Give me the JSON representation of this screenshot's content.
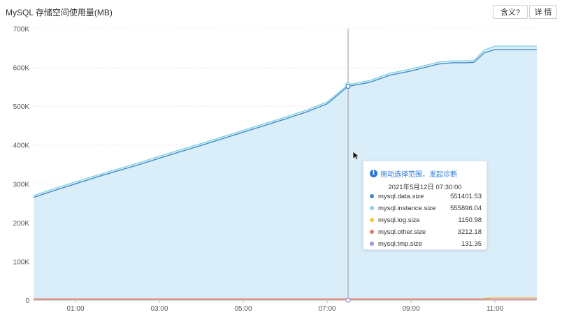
{
  "title": "MySQL 存储空间使用量(MB)",
  "buttons": {
    "meaning": "含义?",
    "detail": "详 情"
  },
  "tooltip": {
    "header": "拖动选择范围，发起诊断",
    "time": "2021年5月12日 07:30:00",
    "rows": [
      {
        "name": "mysql.data.size",
        "value": "551401.53",
        "color": "#3d85c6"
      },
      {
        "name": "mysql.instance.size",
        "value": "555896.04",
        "color": "#7fd3e0"
      },
      {
        "name": "mysql.log.size",
        "value": "1150.98",
        "color": "#f2c744"
      },
      {
        "name": "mysql.other.size",
        "value": "3212.18",
        "color": "#e8786f"
      },
      {
        "name": "mysql.tmp.size",
        "value": "131.35",
        "color": "#a88fd6"
      }
    ]
  },
  "chart_data": {
    "type": "area",
    "x_tick_labels": [
      "01:00",
      "03:00",
      "05:00",
      "07:00",
      "09:00",
      "11:00"
    ],
    "y_tick_labels": [
      "0",
      "100K",
      "200K",
      "300K",
      "400K",
      "500K",
      "600K",
      "700K"
    ],
    "ylim": [
      0,
      700000
    ],
    "xlim": [
      "00:00",
      "12:00"
    ],
    "x": [
      "00:00",
      "00:30",
      "01:00",
      "01:30",
      "02:00",
      "02:30",
      "03:00",
      "03:30",
      "04:00",
      "04:30",
      "05:00",
      "05:30",
      "06:00",
      "06:30",
      "07:00",
      "07:30",
      "08:00",
      "08:30",
      "09:00",
      "09:20",
      "09:40",
      "10:00",
      "10:20",
      "10:30",
      "10:45",
      "11:00",
      "11:30",
      "12:00"
    ],
    "series": [
      {
        "name": "mysql.instance.size",
        "color": "#7fd3e0",
        "values": [
          270000,
          288000,
          305000,
          322000,
          338000,
          354000,
          371000,
          388000,
          404000,
          421000,
          438000,
          455000,
          472000,
          490000,
          511000,
          555900,
          566000,
          585000,
          596000,
          605000,
          614000,
          617000,
          617000,
          618000,
          645000,
          655000,
          655000,
          655000
        ]
      },
      {
        "name": "mysql.data.size",
        "color": "#3d85c6",
        "values": [
          265000,
          283000,
          300000,
          317000,
          333000,
          349000,
          366000,
          383000,
          399000,
          416000,
          433000,
          450000,
          467000,
          485000,
          506000,
          551400,
          561000,
          580000,
          591000,
          600000,
          609000,
          612000,
          612000,
          613000,
          638000,
          646000,
          646000,
          646000
        ]
      },
      {
        "name": "mysql.log.size",
        "color": "#f2c744",
        "values": [
          1100,
          1100,
          1100,
          1100,
          1100,
          1100,
          1100,
          1100,
          1100,
          1100,
          1100,
          1100,
          1100,
          1100,
          1150,
          1151,
          1150,
          1150,
          1150,
          1150,
          1150,
          1150,
          1150,
          1150,
          4000,
          8000,
          8000,
          8000
        ]
      },
      {
        "name": "mysql.other.size",
        "color": "#e8786f",
        "values": [
          3200,
          3200,
          3200,
          3200,
          3200,
          3200,
          3200,
          3200,
          3200,
          3200,
          3200,
          3200,
          3200,
          3200,
          3210,
          3212,
          3212,
          3212,
          3212,
          3212,
          3212,
          3212,
          3212,
          3212,
          3212,
          3212,
          3212,
          3212
        ]
      },
      {
        "name": "mysql.tmp.size",
        "color": "#a88fd6",
        "values": [
          130,
          130,
          130,
          130,
          130,
          130,
          130,
          130,
          130,
          130,
          130,
          130,
          130,
          130,
          131,
          131,
          131,
          131,
          131,
          131,
          131,
          131,
          131,
          131,
          131,
          131,
          131,
          131
        ]
      }
    ],
    "hover_x": "07:30",
    "grid": true
  }
}
